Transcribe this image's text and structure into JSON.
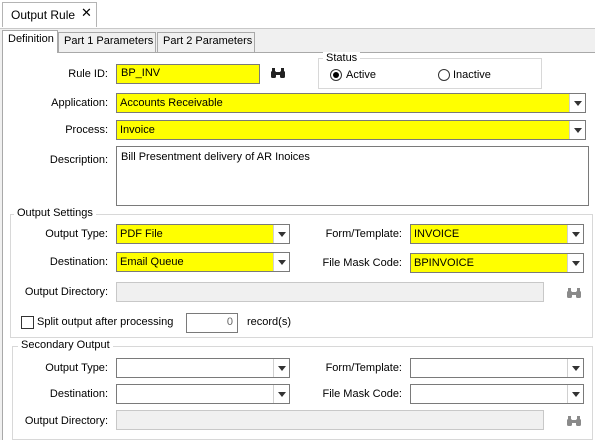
{
  "document_tab": {
    "title": "Output Rule",
    "close": "✕"
  },
  "subtabs": [
    "Definition",
    "Part 1 Parameters",
    "Part 2 Parameters"
  ],
  "rule_id": {
    "label": "Rule ID:",
    "value": "BP_INV"
  },
  "status": {
    "label": "Status",
    "active": "Active",
    "inactive": "Inactive",
    "selected": "Active"
  },
  "application": {
    "label": "Application:",
    "value": "Accounts Receivable"
  },
  "process": {
    "label": "Process:",
    "value": "Invoice"
  },
  "description": {
    "label": "Description:",
    "value": "Bill Presentment delivery of AR Inoices"
  },
  "output_settings": {
    "title": "Output Settings",
    "output_type_label": "Output Type:",
    "output_type": "PDF File",
    "destination_label": "Destination:",
    "destination": "Email Queue",
    "form_template_label": "Form/Template:",
    "form_template": "INVOICE",
    "file_mask_label": "File Mask Code:",
    "file_mask": "BPINVOICE",
    "output_directory_label": "Output Directory:",
    "output_directory": ""
  },
  "split": {
    "label": "Split output after processing",
    "count": "0",
    "unit": "record(s)",
    "checked": false
  },
  "secondary_output": {
    "title": "Secondary Output",
    "output_type_label": "Output  Type:",
    "output_type": "",
    "destination_label": "Destination:",
    "destination": "",
    "form_template_label": "Form/Template:",
    "form_template": "",
    "file_mask_label": "File Mask Code:",
    "file_mask": "",
    "output_directory_label": "Output Directory:",
    "output_directory": ""
  },
  "colors": {
    "required_field": "#ffff00",
    "panel": "#f0f0f0"
  }
}
